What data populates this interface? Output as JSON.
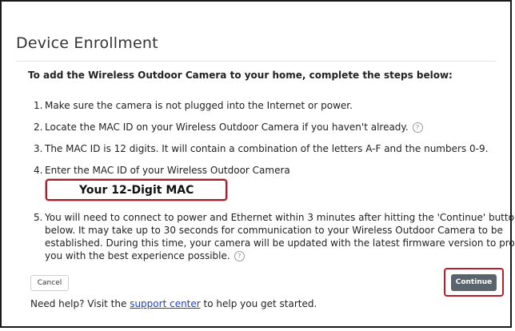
{
  "dialog": {
    "title": "Device Enrollment",
    "intro": "To add the Wireless Outdoor Camera to your home, complete the steps below:"
  },
  "steps": [
    {
      "num": "1.",
      "text": "Make sure the camera is not plugged into the Internet or power."
    },
    {
      "num": "2.",
      "text": "Locate the MAC ID on your Wireless Outdoor Camera if you haven't already."
    },
    {
      "num": "3.",
      "text": "The MAC ID is 12 digits. It will contain a combination of the letters A-F and the numbers 0-9."
    },
    {
      "num": "4.",
      "text": "Enter the MAC ID of your Wireless Outdoor Camera"
    },
    {
      "num": "5.",
      "lines": [
        "You will need to connect to power and Ethernet within 3 minutes after hitting the 'Continue' button",
        "below. It may take up to 30 seconds for communication to your Wireless Outdoor Camera to be",
        "established. During this time, your camera will be updated with the latest firmware version to provide",
        "you with the best experience possible."
      ]
    }
  ],
  "mac_input": {
    "placeholder": "Your 12-Digit MAC",
    "value": ""
  },
  "help_icon_glyph": "?",
  "buttons": {
    "cancel": "Cancel",
    "continue": "Continue"
  },
  "footer": {
    "prefix": "Need help? Visit the ",
    "link": "support center",
    "suffix": " to help you get started."
  },
  "colors": {
    "highlight_border": "#b5202b",
    "continue_bg": "#5a646c",
    "link": "#1a3fd6"
  }
}
